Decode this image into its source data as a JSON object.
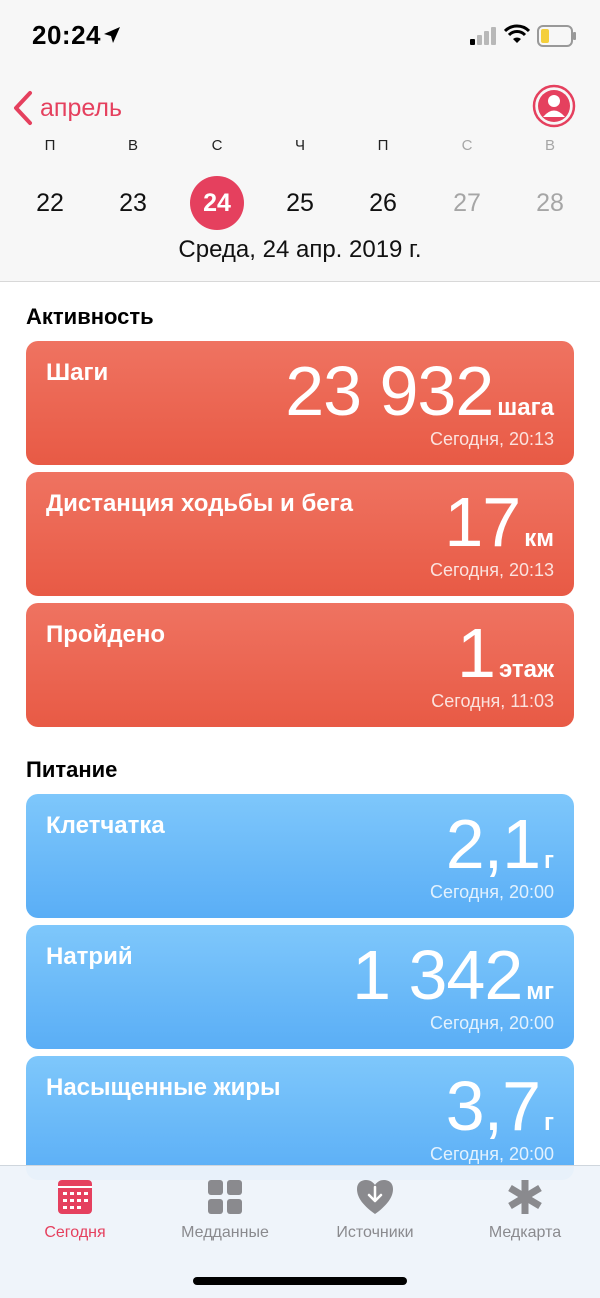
{
  "status_bar": {
    "time": "20:24"
  },
  "header": {
    "back_label": "апрель",
    "week_letters": [
      "П",
      "В",
      "С",
      "Ч",
      "П",
      "С",
      "В"
    ],
    "week_days": [
      "22",
      "23",
      "24",
      "25",
      "26",
      "27",
      "28"
    ],
    "selected_index": 2,
    "date_line": "Среда, 24 апр. 2019 г."
  },
  "accent_color": "#e5405e",
  "activity": {
    "title": "Активность",
    "cards": [
      {
        "title": "Шаги",
        "value": "23 932",
        "unit": "шага",
        "time": "Сегодня, 20:13"
      },
      {
        "title": "Дистанция ходьбы и бега",
        "value": "17",
        "unit": "км",
        "time": "Сегодня, 20:13"
      },
      {
        "title": "Пройдено",
        "value": "1",
        "unit": "этаж",
        "time": "Сегодня, 11:03"
      }
    ]
  },
  "nutrition": {
    "title": "Питание",
    "cards": [
      {
        "title": "Клетчатка",
        "value": "2,1",
        "unit": "г",
        "time": "Сегодня, 20:00"
      },
      {
        "title": "Натрий",
        "value": "1 342",
        "unit": "мг",
        "time": "Сегодня, 20:00"
      },
      {
        "title": "Насыщенные жиры",
        "value": "3,7",
        "unit": "г",
        "time": "Сегодня, 20:00"
      }
    ]
  },
  "tabs": [
    {
      "label": "Сегодня",
      "icon": "calendar-icon",
      "active": true
    },
    {
      "label": "Медданные",
      "icon": "grid-icon",
      "active": false
    },
    {
      "label": "Источники",
      "icon": "heart-download-icon",
      "active": false
    },
    {
      "label": "Медкарта",
      "icon": "asterisk-icon",
      "active": false
    }
  ]
}
